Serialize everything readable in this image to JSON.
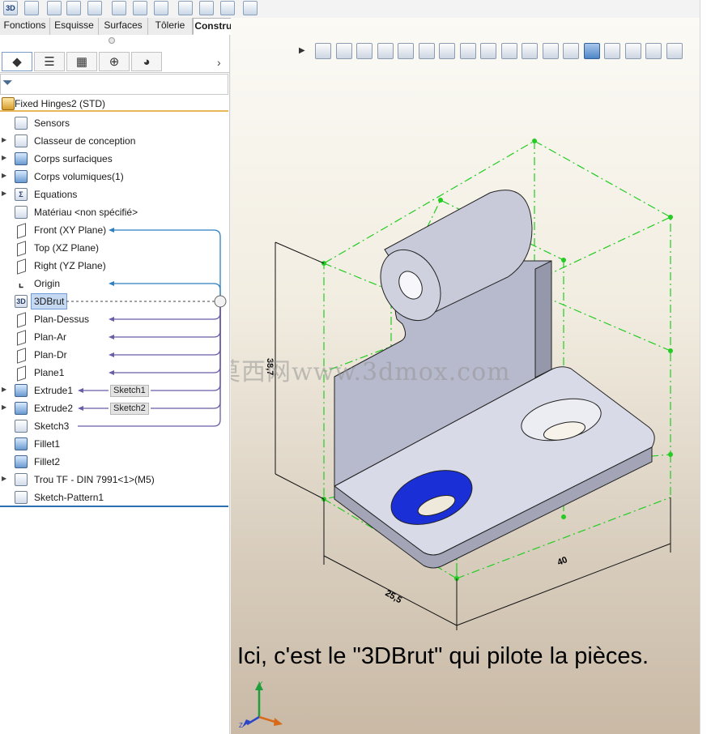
{
  "toolbar": {
    "icons": [
      "3d-sketch-icon",
      "part-icon",
      "feature-icon",
      "feature-icon",
      "feature-icon",
      "feature-icon",
      "feature-icon",
      "feature-icon",
      "feature-icon",
      "feature-icon",
      "feature-icon",
      "feature-icon",
      "feature-icon",
      "feature-icon",
      "reference-geometry-icon"
    ],
    "first_icon_text": "3D"
  },
  "tabs": [
    {
      "label": "Fonctions",
      "active": false
    },
    {
      "label": "Esquisse",
      "active": false
    },
    {
      "label": "Surfaces",
      "active": false
    },
    {
      "label": "Tôlerie",
      "active": false
    },
    {
      "label": "Constructions soudées",
      "active": true
    }
  ],
  "panel_tabs": [
    "feature-manager-icon",
    "property-manager-icon",
    "configuration-manager-icon",
    "dimxpert-icon",
    "display-manager-icon"
  ],
  "tree": {
    "root": "Fixed Hinges2  (STD)",
    "items": [
      {
        "label": "Sensors",
        "icon": "sensors-icon",
        "expandable": false
      },
      {
        "label": "Classeur de conception",
        "icon": "design-binder-icon",
        "expandable": true
      },
      {
        "label": "Corps surfaciques",
        "icon": "surface-bodies-icon",
        "expandable": true
      },
      {
        "label": "Corps volumiques(1)",
        "icon": "solid-bodies-icon",
        "expandable": true
      },
      {
        "label": "Equations",
        "icon": "equations-icon",
        "expandable": true
      },
      {
        "label": "Matériau <non spécifié>",
        "icon": "material-icon",
        "expandable": false
      },
      {
        "label": "Front (XY Plane)",
        "icon": "plane-icon",
        "expandable": false
      },
      {
        "label": "Top (XZ Plane)",
        "icon": "plane-icon",
        "expandable": false
      },
      {
        "label": "Right (YZ Plane)",
        "icon": "plane-icon",
        "expandable": false
      },
      {
        "label": "Origin",
        "icon": "origin-icon",
        "expandable": false
      },
      {
        "label": "3DBrut",
        "icon": "3d-sketch-icon",
        "expandable": false,
        "selected": true
      },
      {
        "label": "Plan-Dessus",
        "icon": "plane-icon",
        "expandable": false
      },
      {
        "label": "Plan-Ar",
        "icon": "plane-icon",
        "expandable": false
      },
      {
        "label": "Plan-Dr",
        "icon": "plane-icon",
        "expandable": false
      },
      {
        "label": "Plane1",
        "icon": "plane-icon",
        "expandable": false
      },
      {
        "label": "Extrude1",
        "icon": "extrude-icon",
        "expandable": true,
        "tag": "Sketch1"
      },
      {
        "label": "Extrude2",
        "icon": "extrude-icon",
        "expandable": true,
        "tag": "Sketch2"
      },
      {
        "label": "Sketch3",
        "icon": "sketch-icon",
        "expandable": false
      },
      {
        "label": "Fillet1",
        "icon": "fillet-icon",
        "expandable": false
      },
      {
        "label": "Fillet2",
        "icon": "fillet-icon",
        "expandable": false
      },
      {
        "label": "Trou TF - DIN 7991<1>(M5)",
        "icon": "hole-wizard-icon",
        "expandable": true
      },
      {
        "label": "Sketch-Pattern1",
        "icon": "sketch-pattern-icon",
        "expandable": false
      }
    ]
  },
  "viewport": {
    "dimensions": [
      "25,5",
      "40",
      "38,7"
    ],
    "watermark": "莫西网www.3dmox.com",
    "caption": "Ici, c'est le \"3DBrut\" qui pilote la pièces.",
    "heads_up_icons": [
      "zoom-to-fit-icon",
      "zoom-to-area-icon",
      "previous-view-icon",
      "section-view-icon",
      "dynamic-annotation-icon",
      "camera-icon",
      "view-icon",
      "annotation-icon",
      "zoom-icon",
      "zoom-in-out-icon",
      "rotate-icon",
      "pan-icon",
      "view-orientation-icon",
      "display-style-icon",
      "hide-show-icon",
      "edit-appearance-icon",
      "apply-scene-icon",
      "view-settings-icon"
    ]
  },
  "colors": {
    "link_blue": "#2d7fc1",
    "link_purple": "#6b5ca8",
    "sketch_green": "#22cc22",
    "hole_blue": "#1a2fd6",
    "panel_accent": "#e7b75a"
  }
}
